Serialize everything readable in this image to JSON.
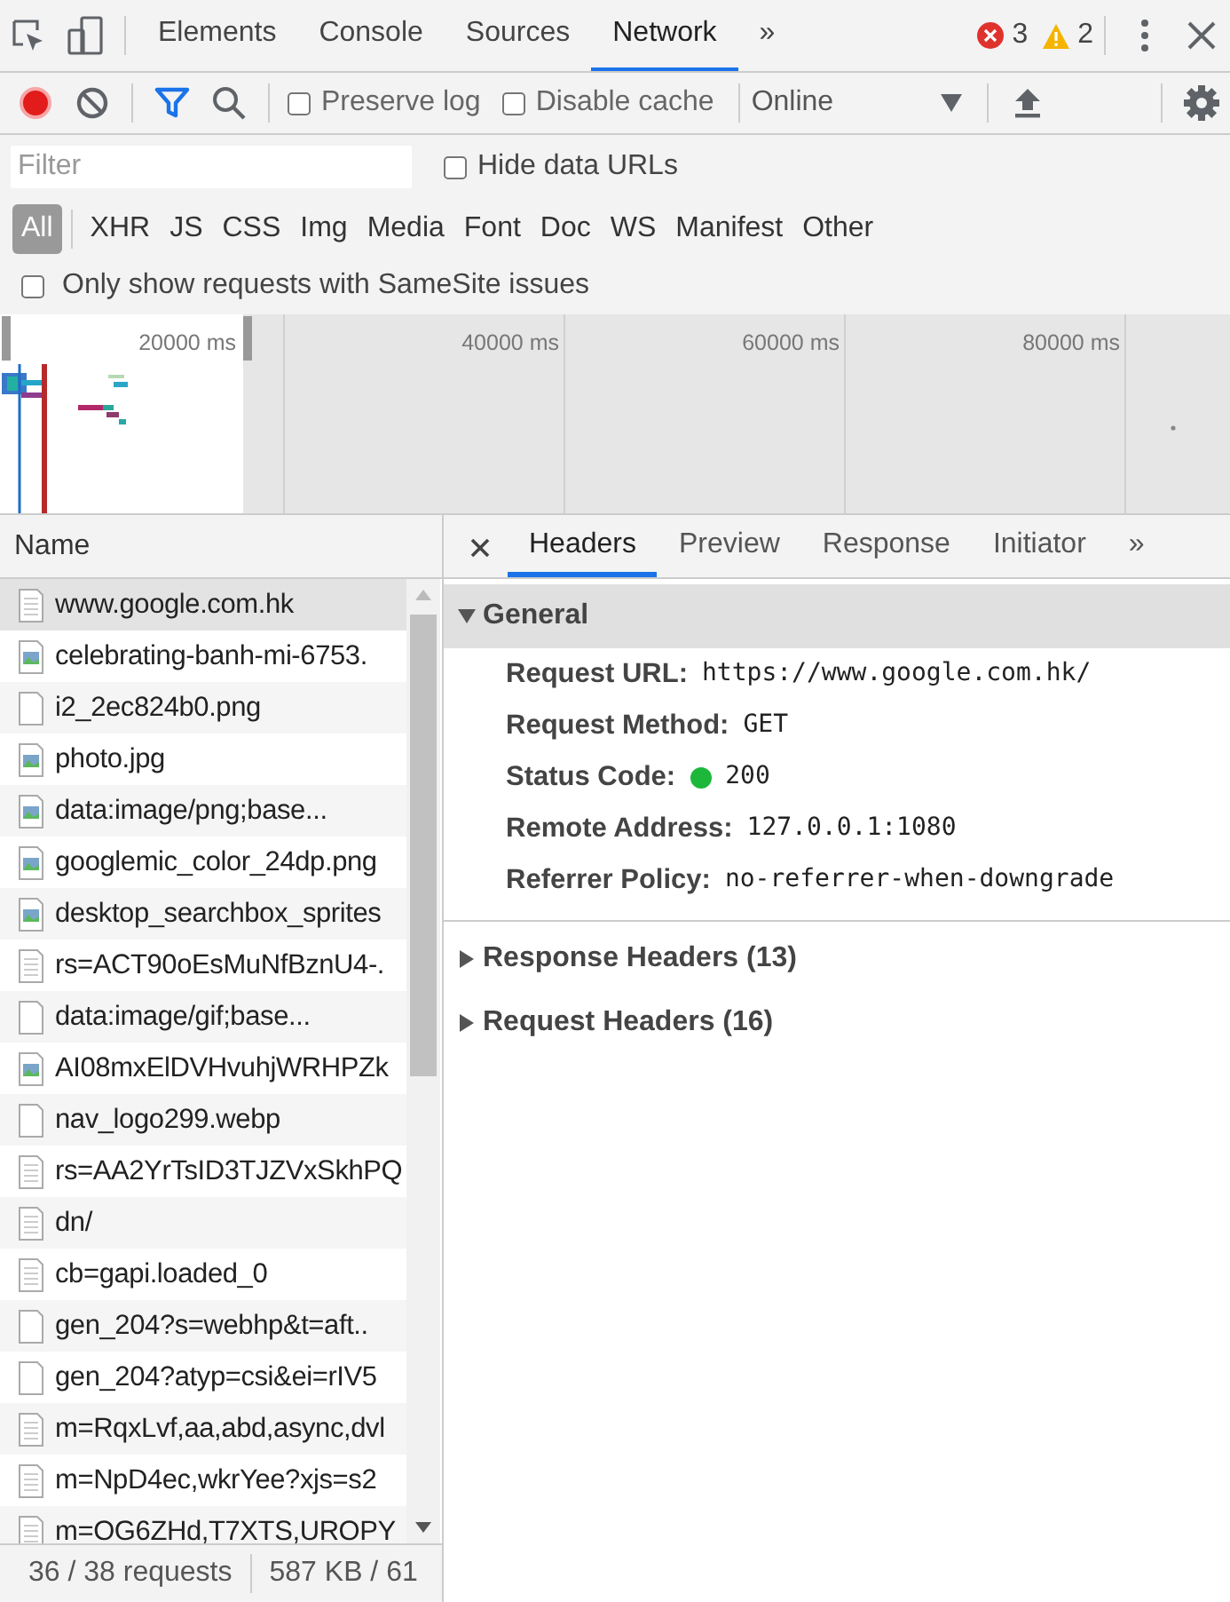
{
  "main_tabs": [
    {
      "label": "Elements",
      "selected": false
    },
    {
      "label": "Console",
      "selected": false
    },
    {
      "label": "Sources",
      "selected": false
    },
    {
      "label": "Network",
      "selected": true
    }
  ],
  "more_tabs": "»",
  "errors": {
    "count": "3"
  },
  "warnings": {
    "count": "2"
  },
  "toolbar": {
    "recording": true,
    "filter_active": true,
    "checkboxes": [
      {
        "label": "Preserve log",
        "checked": false
      },
      {
        "label": "Disable cache",
        "checked": false
      }
    ],
    "throttling": "Online"
  },
  "filter": {
    "placeholder": "Filter",
    "hide_data_urls": {
      "label": "Hide data URLs",
      "checked": false
    }
  },
  "type_filters": [
    {
      "label": "All",
      "selected": true
    },
    {
      "label": "XHR",
      "selected": false
    },
    {
      "label": "JS",
      "selected": false
    },
    {
      "label": "CSS",
      "selected": false
    },
    {
      "label": "Img",
      "selected": false
    },
    {
      "label": "Media",
      "selected": false
    },
    {
      "label": "Font",
      "selected": false
    },
    {
      "label": "Doc",
      "selected": false
    },
    {
      "label": "WS",
      "selected": false
    },
    {
      "label": "Manifest",
      "selected": false
    },
    {
      "label": "Other",
      "selected": false
    }
  ],
  "samesite": {
    "label": "Only show requests with SameSite issues",
    "checked": false
  },
  "overview": {
    "ticks": [
      "20000 ms",
      "40000 ms",
      "60000 ms",
      "80000 ms"
    ]
  },
  "requests": {
    "column": "Name",
    "rows": [
      {
        "name": "www.google.com.hk",
        "kind": "doc",
        "selected": true
      },
      {
        "name": "celebrating-banh-mi-6753.",
        "kind": "image",
        "selected": false
      },
      {
        "name": "i2_2ec824b0.png",
        "kind": "blank",
        "selected": false
      },
      {
        "name": "photo.jpg",
        "kind": "image",
        "selected": false
      },
      {
        "name": "data:image/png;base...",
        "kind": "image",
        "selected": false
      },
      {
        "name": "googlemic_color_24dp.png",
        "kind": "image",
        "selected": false
      },
      {
        "name": "desktop_searchbox_sprites",
        "kind": "image",
        "selected": false
      },
      {
        "name": "rs=ACT90oEsMuNfBznU4-.",
        "kind": "doc",
        "selected": false
      },
      {
        "name": "data:image/gif;base...",
        "kind": "blank",
        "selected": false
      },
      {
        "name": "AI08mxElDVHvuhjWRHPZk",
        "kind": "image",
        "selected": false
      },
      {
        "name": "nav_logo299.webp",
        "kind": "blank",
        "selected": false
      },
      {
        "name": "rs=AA2YrTsID3TJZVxSkhPQ",
        "kind": "doc",
        "selected": false
      },
      {
        "name": "dn/",
        "kind": "doc",
        "selected": false
      },
      {
        "name": "cb=gapi.loaded_0",
        "kind": "doc",
        "selected": false
      },
      {
        "name": "gen_204?s=webhp&t=aft..",
        "kind": "blank",
        "selected": false
      },
      {
        "name": "gen_204?atyp=csi&ei=rIV5",
        "kind": "blank",
        "selected": false
      },
      {
        "name": "m=RqxLvf,aa,abd,async,dvl",
        "kind": "doc",
        "selected": false
      },
      {
        "name": "m=NpD4ec,wkrYee?xjs=s2",
        "kind": "doc",
        "selected": false
      },
      {
        "name": "m=OG6ZHd,T7XTS,UROPY",
        "kind": "doc",
        "selected": false
      }
    ]
  },
  "status_bar": [
    "36 / 38 requests",
    "587 KB / 61"
  ],
  "detail": {
    "tabs": [
      {
        "label": "Headers",
        "selected": true
      },
      {
        "label": "Preview",
        "selected": false
      },
      {
        "label": "Response",
        "selected": false
      },
      {
        "label": "Initiator",
        "selected": false
      }
    ],
    "more_tabs": "»",
    "sections": [
      {
        "title": "General",
        "expanded": true,
        "fields": [
          {
            "label": "Request URL:",
            "value": "https://www.google.com.hk/"
          },
          {
            "label": "Request Method:",
            "value": "GET"
          },
          {
            "label": "Status Code:",
            "value": "200",
            "color": "#1db83a"
          },
          {
            "label": "Remote Address:",
            "value": "127.0.0.1:1080"
          },
          {
            "label": "Referrer Policy:",
            "value": "no-referrer-when-downgrade"
          }
        ]
      },
      {
        "title": "Response Headers (13)",
        "expanded": false
      },
      {
        "title": "Request Headers (16)",
        "expanded": false
      }
    ]
  }
}
